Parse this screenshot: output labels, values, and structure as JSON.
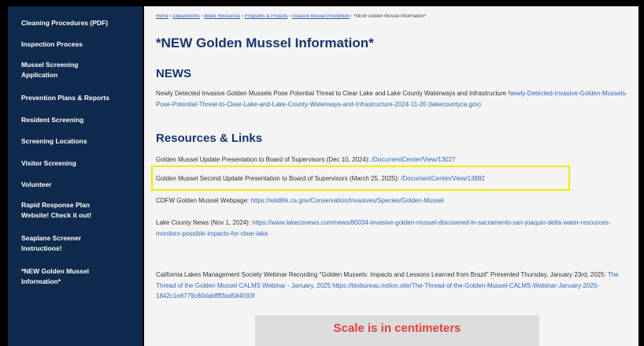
{
  "sidebar": {
    "items": [
      {
        "label": "Cleaning Procedures (PDF)"
      },
      {
        "label": "Inspection Process"
      },
      {
        "label": "Mussel Screening Application"
      },
      {
        "label": "Prevention Plans & Reports"
      },
      {
        "label": "Resident Screening"
      },
      {
        "label": "Screening Locations"
      },
      {
        "label": "Visitor Screening"
      },
      {
        "label": "Volunteer"
      },
      {
        "label": "Rapid Response Plan Website! Check it out!"
      },
      {
        "label": "Seaplane Screener Instructions!"
      },
      {
        "label": "*NEW Golden Mussel Information*"
      }
    ]
  },
  "breadcrumb": {
    "items": [
      "Home",
      "Departments",
      "Water Resources",
      "Programs & Projects",
      "Invasive Mussel Prevention"
    ],
    "separator": " › ",
    "current": "*NEW Golden Mussel Information*"
  },
  "page": {
    "title": "*NEW Golden Mussel Information*"
  },
  "news": {
    "heading": "NEWS",
    "text": "Newly Detected Invasive Golden Mussels Pose Potential Threat to Clear Lake and Lake County Waterways and Infrastructure ",
    "link": "Newly-Detected-Invasive-Golden-Mussels-Pose-Potential-Threat-to-Clear-Lake-and-Lake-County-Waterways-and-Infrastructure-2024-11-20 (lakecountyca.gov)"
  },
  "resources": {
    "heading": "Resources & Links",
    "items": [
      {
        "text": "Golden Mussel Update Presentation to Board of Supervisors (Dec 10, 2024): ",
        "link": "/DocumentCenter/View/13027"
      },
      {
        "text": "Golden Mussel Second Update Presentation to Board of Supervisors (March 25, 2025): ",
        "link": "/DocumentCenter/View/13882"
      },
      {
        "text": "CDFW Golden Mussel Webpage: ",
        "link": "https://wildlife.ca.gov/Conservation/Invasives/Species/Golden-Mussel"
      },
      {
        "text": "Lake County News (Nov 1, 2024): ",
        "link": "https://www.lakeconews.com/news/80034-invasive-golden-mussel-discovered-in-sacramento-san-joaquin-delta-water-resources-monitors-possible-impacts-for-clear-lake"
      },
      {
        "text": "California Lakes Management Society Webinar Recording \"Golden Mussels: Impacts and Lessons Learned from Brazil\" Presented Thursday, January 23rd, 2025: ",
        "link": "The Thread of the Golden Mussel CALMS Webinar - January, 2025 https://biobureau.notion.site/The-Thread-of-the-Golden-Mussel-CALMS-Webinar-January-2025-1842c1e8779c80dabffff3ad584593f"
      }
    ]
  },
  "image": {
    "caption": "Scale is in centimeters"
  },
  "colors": {
    "sidebar_bg": "#0f2a4c",
    "heading": "#16366c",
    "link": "#2f6ab3",
    "highlight": "#f1ec00",
    "caption": "#e0413c"
  }
}
